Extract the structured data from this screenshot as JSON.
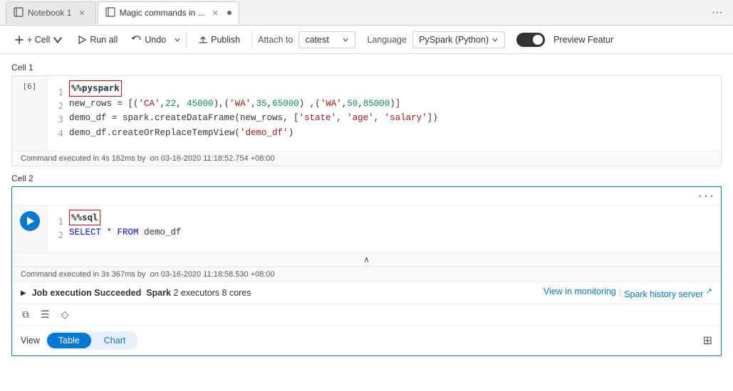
{
  "tabs": [
    {
      "id": "notebook1",
      "label": "Notebook 1",
      "active": false,
      "icon": "📓"
    },
    {
      "id": "magic-commands",
      "label": "Magic commands in ...",
      "active": true,
      "icon": "📓"
    }
  ],
  "toolbar": {
    "cell_label": "+ Cell",
    "run_all_label": "Run all",
    "undo_label": "Undo",
    "publish_label": "Publish",
    "attach_to_label": "Attach to",
    "attach_value": "catest",
    "language_label": "Language",
    "language_value": "PySpark (Python)",
    "preview_label": "Preview Featur"
  },
  "cell1": {
    "label": "Cell 1",
    "run_indicator": "[6]",
    "lines": [
      {
        "num": "1",
        "content": "%%pyspark",
        "type": "magic"
      },
      {
        "num": "2",
        "content": "new_rows = [('CA',22, 45000),('WA',35,65000) ,('WA',50,85000)]",
        "type": "code"
      },
      {
        "num": "3",
        "content": "demo_df = spark.createDataFrame(new_rows, ['state', 'age', 'salary'])",
        "type": "code"
      },
      {
        "num": "4",
        "content": "demo_df.createOrReplaceTempView('demo_df')",
        "type": "code"
      }
    ],
    "status": "Command executed in 4s 162ms by",
    "timestamp": "on 03-16-2020 11:18:52.754 +08:00"
  },
  "cell2": {
    "label": "Cell 2",
    "lines": [
      {
        "num": "1",
        "content": "%%sql",
        "type": "magic"
      },
      {
        "num": "2",
        "content": "SELECT * FROM demo_df",
        "type": "sql"
      }
    ],
    "status": "Command executed in 3s 367ms by",
    "timestamp": "on 03-16-2020 11:18:58.530 +08:00",
    "job_text_prefix": "Job execution",
    "job_status": "Succeeded",
    "job_detail": "Spark",
    "job_executors": "2 executors",
    "job_cores": "8 cores",
    "view_monitoring_label": "View in monitoring",
    "spark_history_label": "Spark history server",
    "view_label": "View",
    "table_label": "Table",
    "chart_label": "Chart"
  }
}
